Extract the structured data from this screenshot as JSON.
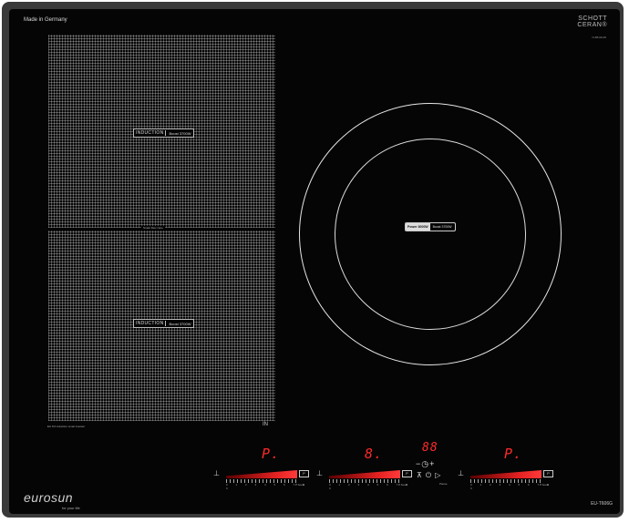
{
  "header": {
    "made_in": "Made in Germany",
    "glass_brand_line1": "SCHOTT",
    "glass_brand_line2": "CERAN®",
    "serial": "N-3B-00-00"
  },
  "left_zones": {
    "top_label": {
      "induction": "INDUCTION",
      "booster": "Boost 3700W"
    },
    "bottom_label": {
      "induction": "INDUCTION",
      "booster": "Boost 3700W"
    },
    "separator_label": "Smart Flex zone",
    "bottom_note": "EU 8.6 induction smart booster",
    "bottom_icon": "IN"
  },
  "right_zone": {
    "power": "Power 3000W",
    "booster": "Boost 3700W"
  },
  "controls": {
    "display_1": "P.",
    "display_2": "8.",
    "display_3": "P.",
    "timer_display": "88",
    "timer_minus_plus": "−◷+",
    "pause_label": "Pause",
    "slider_numbers": "0 1 2 3 4 5 6 7 8 9",
    "boost_label": "P boost",
    "boost_icon_label": "P"
  },
  "brand": {
    "logo": "eurosun",
    "tagline": "for your life",
    "model": "EU-T606G"
  },
  "colors": {
    "glass": "#050505",
    "frame": "#3a3a3a",
    "display_red": "#ff2a2a"
  }
}
